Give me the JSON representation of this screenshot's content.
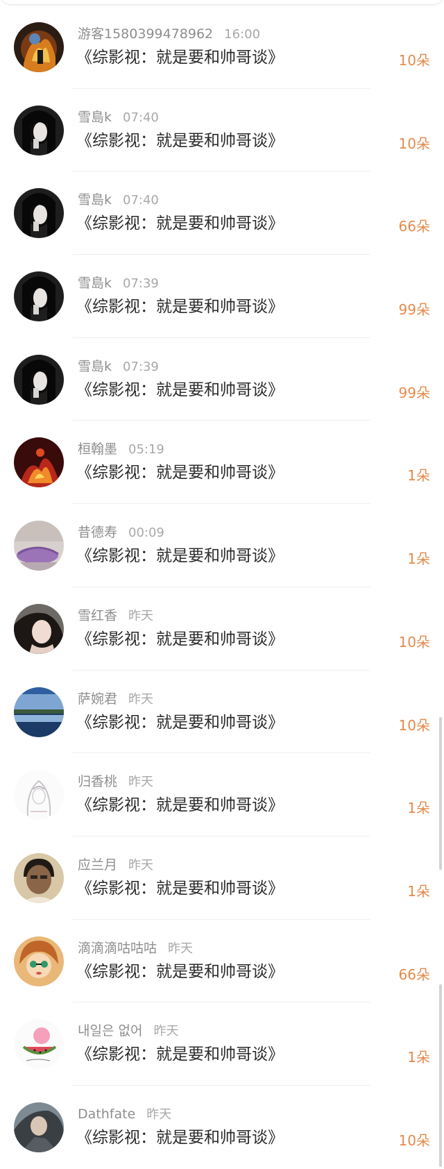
{
  "gifts": [
    {
      "user": "游客1580399478962",
      "time": "16:00",
      "title": "《综影视：就是要和帅哥谈》",
      "amount": "10朵",
      "avatar": "fire-figure-avatar"
    },
    {
      "user": "雪島k",
      "time": "07:40",
      "title": "《综影视：就是要和帅哥谈》",
      "amount": "10朵",
      "avatar": "dark-girl-avatar"
    },
    {
      "user": "雪島k",
      "time": "07:40",
      "title": "《综影视：就是要和帅哥谈》",
      "amount": "66朵",
      "avatar": "dark-girl-avatar"
    },
    {
      "user": "雪島k",
      "time": "07:39",
      "title": "《综影视：就是要和帅哥谈》",
      "amount": "99朵",
      "avatar": "dark-girl-avatar"
    },
    {
      "user": "雪島k",
      "time": "07:39",
      "title": "《综影视：就是要和帅哥谈》",
      "amount": "99朵",
      "avatar": "dark-girl-avatar"
    },
    {
      "user": "桓翰墨",
      "time": "05:19",
      "title": "《综影视：就是要和帅哥谈》",
      "amount": "1朵",
      "avatar": "fire-phoenix-avatar"
    },
    {
      "user": "昔德寿",
      "time": "00:09",
      "title": "《综影视：就是要和帅哥谈》",
      "amount": "1朵",
      "avatar": "purple-umbrella-avatar"
    },
    {
      "user": "雪红香",
      "time": "昨天",
      "title": "《综影视：就是要和帅哥谈》",
      "amount": "10朵",
      "avatar": "woman-portrait-avatar"
    },
    {
      "user": "萨婉君",
      "time": "昨天",
      "title": "《综影视：就是要和帅哥谈》",
      "amount": "10朵",
      "avatar": "lake-landscape-avatar"
    },
    {
      "user": "归香桃",
      "time": "昨天",
      "title": "《综影视：就是要和帅哥谈》",
      "amount": "1朵",
      "avatar": "anime-sketch-avatar"
    },
    {
      "user": "应兰月",
      "time": "昨天",
      "title": "《综影视：就是要和帅哥谈》",
      "amount": "1朵",
      "avatar": "man-portrait-avatar"
    },
    {
      "user": "滴滴滴咕咕咕",
      "time": "昨天",
      "title": "《综影视：就是要和帅哥谈》",
      "amount": "66朵",
      "avatar": "cartoon-girl-avatar"
    },
    {
      "user": "내일은 없어",
      "time": "昨天",
      "title": "《综影视：就是要和帅哥谈》",
      "amount": "1朵",
      "avatar": "watermelon-avatar"
    },
    {
      "user": "Dathfate",
      "time": "昨天",
      "title": "《综影视：就是要和帅哥谈》",
      "amount": "10朵",
      "avatar": "warrior-avatar"
    }
  ],
  "colors": {
    "accent": "#e58a4b",
    "username": "#8e8e8e",
    "time": "#a8a8a8",
    "title": "#2b2b2b"
  }
}
